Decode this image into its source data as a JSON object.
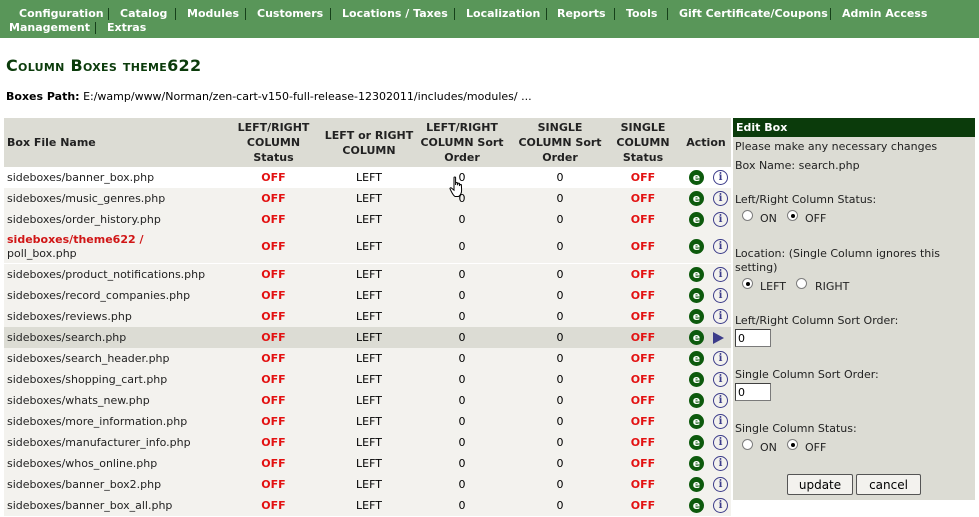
{
  "menu": {
    "items": [
      {
        "label": "Configuration"
      },
      {
        "label": "Catalog"
      },
      {
        "label": "Modules"
      },
      {
        "label": "Customers"
      },
      {
        "label": "Locations / Taxes"
      },
      {
        "label": "Localization"
      },
      {
        "label": "Reports"
      },
      {
        "label": "Tools"
      },
      {
        "label": "Gift Certificate/Coupons"
      },
      {
        "label": "Admin Access Management"
      },
      {
        "label": "Extras"
      }
    ]
  },
  "page": {
    "title": "Column Boxes theme622",
    "boxes_path_label": "Boxes Path:",
    "boxes_path_value": "E:/wamp/www/Norman/zen-cart-v150-full-release-12302011/includes/modules/ ..."
  },
  "table": {
    "headers": {
      "file": "Box File Name",
      "lr_status": "LEFT/RIGHT COLUMN Status",
      "location": "LEFT or RIGHT COLUMN",
      "lr_sort": "LEFT/RIGHT COLUMN Sort Order",
      "single_sort": "SINGLE COLUMN Sort Order",
      "single_status": "SINGLE COLUMN Status",
      "action": "Action"
    },
    "rows": [
      {
        "file": "sideboxes/banner_box.php",
        "lr_status": "OFF",
        "location": "LEFT",
        "lr_sort": "0",
        "single_sort": "0",
        "single_status": "OFF"
      },
      {
        "file": "sideboxes/music_genres.php",
        "lr_status": "OFF",
        "location": "LEFT",
        "lr_sort": "0",
        "single_sort": "0",
        "single_status": "OFF"
      },
      {
        "file": "sideboxes/order_history.php",
        "lr_status": "OFF",
        "location": "LEFT",
        "lr_sort": "0",
        "single_sort": "0",
        "single_status": "OFF"
      },
      {
        "file_theme_part": "sideboxes/theme622 /",
        "file_rest": "poll_box.php",
        "lr_status": "OFF",
        "location": "LEFT",
        "lr_sort": "0",
        "single_sort": "0",
        "single_status": "OFF"
      },
      {
        "file": "sideboxes/product_notifications.php",
        "lr_status": "OFF",
        "location": "LEFT",
        "lr_sort": "0",
        "single_sort": "0",
        "single_status": "OFF"
      },
      {
        "file": "sideboxes/record_companies.php",
        "lr_status": "OFF",
        "location": "LEFT",
        "lr_sort": "0",
        "single_sort": "0",
        "single_status": "OFF"
      },
      {
        "file": "sideboxes/reviews.php",
        "lr_status": "OFF",
        "location": "LEFT",
        "lr_sort": "0",
        "single_sort": "0",
        "single_status": "OFF"
      },
      {
        "file": "sideboxes/search.php",
        "lr_status": "OFF",
        "location": "LEFT",
        "lr_sort": "0",
        "single_sort": "0",
        "single_status": "OFF",
        "selected": true
      },
      {
        "file": "sideboxes/search_header.php",
        "lr_status": "OFF",
        "location": "LEFT",
        "lr_sort": "0",
        "single_sort": "0",
        "single_status": "OFF"
      },
      {
        "file": "sideboxes/shopping_cart.php",
        "lr_status": "OFF",
        "location": "LEFT",
        "lr_sort": "0",
        "single_sort": "0",
        "single_status": "OFF"
      },
      {
        "file": "sideboxes/whats_new.php",
        "lr_status": "OFF",
        "location": "LEFT",
        "lr_sort": "0",
        "single_sort": "0",
        "single_status": "OFF"
      },
      {
        "file": "sideboxes/more_information.php",
        "lr_status": "OFF",
        "location": "LEFT",
        "lr_sort": "0",
        "single_sort": "0",
        "single_status": "OFF"
      },
      {
        "file": "sideboxes/manufacturer_info.php",
        "lr_status": "OFF",
        "location": "LEFT",
        "lr_sort": "0",
        "single_sort": "0",
        "single_status": "OFF"
      },
      {
        "file": "sideboxes/whos_online.php",
        "lr_status": "OFF",
        "location": "LEFT",
        "lr_sort": "0",
        "single_sort": "0",
        "single_status": "OFF"
      },
      {
        "file": "sideboxes/banner_box2.php",
        "lr_status": "OFF",
        "location": "LEFT",
        "lr_sort": "0",
        "single_sort": "0",
        "single_status": "OFF"
      },
      {
        "file": "sideboxes/banner_box_all.php",
        "lr_status": "OFF",
        "location": "LEFT",
        "lr_sort": "0",
        "single_sort": "0",
        "single_status": "OFF"
      }
    ],
    "action_edit_glyph": "e",
    "action_info_glyph": "i",
    "action_edit_icon": "edit-icon",
    "action_info_icon": "info-icon",
    "action_selected_icon": "selected-arrow-icon"
  },
  "edit_box": {
    "title": "Edit Box",
    "intro": "Please make any necessary changes",
    "box_name": "Box Name: search.php",
    "lr_status_label": "Left/Right Column Status:",
    "lr_status_on": "ON",
    "lr_status_off": "OFF",
    "lr_status_selected": "OFF",
    "location_label_1": "Location: (Single Column ignores this",
    "location_label_2": "setting)",
    "location_left": "LEFT",
    "location_right": "RIGHT",
    "location_selected": "LEFT",
    "lr_sort_label": "Left/Right Column Sort Order:",
    "lr_sort_value": "0",
    "single_sort_label": "Single Column Sort Order:",
    "single_sort_value": "0",
    "single_status_label": "Single Column Status:",
    "single_status_on": "ON",
    "single_status_off": "OFF",
    "single_status_selected": "OFF",
    "update_button": "update",
    "cancel_button": "cancel"
  },
  "colors": {
    "menu_bg": "#599659",
    "title": "#0b3b0b",
    "off_red": "#e31111",
    "theme_red": "#d01616",
    "edit_icon": "#0d5a0d",
    "info_icon": "#3c3c8a",
    "panel_head": "#0b3b0b"
  }
}
